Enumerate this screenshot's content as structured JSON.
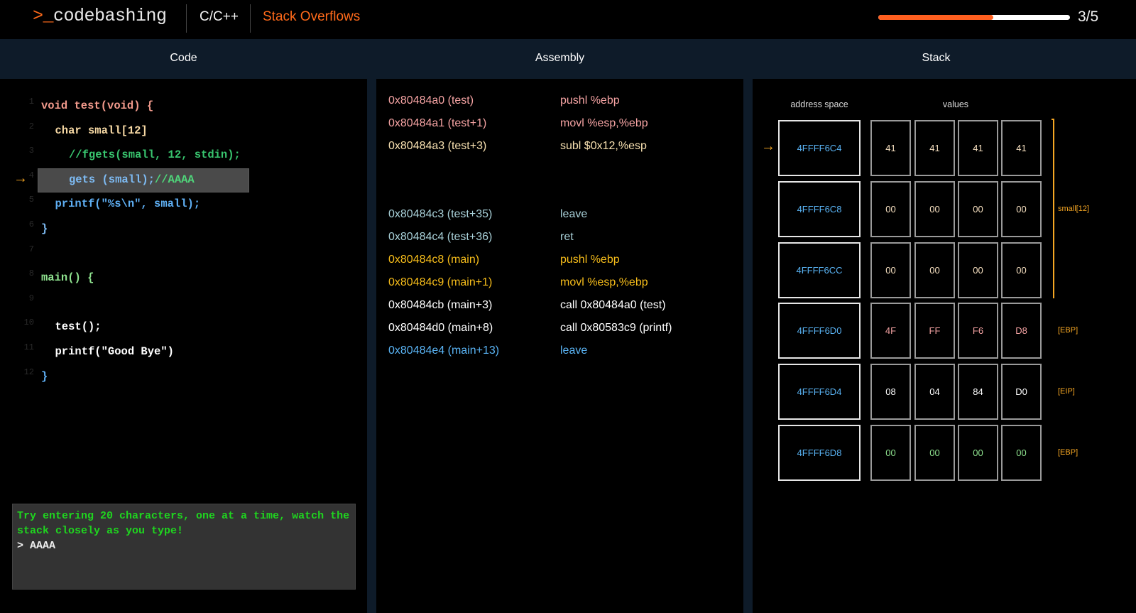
{
  "header": {
    "logo_prompt": ">_",
    "logo_text": "codebashing",
    "language": "C/C++",
    "lesson": "Stack Overflows",
    "progress_percent": 60,
    "step": "3/5",
    "colors": {
      "accent": "#ff6a1a"
    }
  },
  "columns": {
    "code": "Code",
    "assembly": "Assembly",
    "stack": "Stack"
  },
  "code": {
    "current_line": 4,
    "current_line_icon": "arrow-right-icon",
    "lines": [
      {
        "n": "1",
        "parts": [
          {
            "t": "void test(void) {",
            "c": "#f29a8c"
          }
        ],
        "indent": 0
      },
      {
        "n": "2",
        "parts": [
          {
            "t": "char small[12]",
            "c": "#f7d9a4"
          }
        ],
        "indent": 1
      },
      {
        "n": "3",
        "parts": [
          {
            "t": "//fgets(small, 12, stdin);",
            "c": "#38c46e"
          }
        ],
        "indent": 2
      },
      {
        "n": "4",
        "parts": [
          {
            "t": "gets (small);",
            "c": "#7dbaf2"
          },
          {
            "t": "//AAAA",
            "c": "#4fd67a"
          }
        ],
        "indent": 2
      },
      {
        "n": "5",
        "parts": [
          {
            "t": "printf(\"%s\\n\", small);",
            "c": "#5fb0f5"
          }
        ],
        "indent": 1
      },
      {
        "n": "6",
        "parts": [
          {
            "t": "}",
            "c": "#7dbaf2"
          }
        ],
        "indent": 0
      },
      {
        "n": "7",
        "parts": [],
        "indent": 0
      },
      {
        "n": "8",
        "parts": [
          {
            "t": "main() {",
            "c": "#8fe38f"
          }
        ],
        "indent": 0
      },
      {
        "n": "9",
        "parts": [],
        "indent": 0
      },
      {
        "n": "10",
        "parts": [
          {
            "t": "test();",
            "c": "#ffffff"
          }
        ],
        "indent": 1
      },
      {
        "n": "11",
        "parts": [
          {
            "t": "printf(\"Good Bye\")",
            "c": "#ffffff"
          }
        ],
        "indent": 1
      },
      {
        "n": "12",
        "parts": [
          {
            "t": "}",
            "c": "#5fb0f5"
          }
        ],
        "indent": 0
      }
    ]
  },
  "terminal": {
    "message": "Try entering 20 characters, one at a time, watch the stack closely as you type!",
    "prompt": "> AAAA"
  },
  "assembly": [
    {
      "addr": "0x80484a0 (test)",
      "instr": "pushl %ebp",
      "c": "#f5a3a3"
    },
    {
      "addr": "0x80484a1 (test+1)",
      "instr": "movl %esp,%ebp",
      "c": "#f5a3a3"
    },
    {
      "addr": "0x80484a3 (test+3)",
      "instr": "subl $0x12,%esp",
      "c": "#f7e0b0"
    },
    {
      "addr": "0x80484c3 (test+35)",
      "instr": "leave",
      "c": "#a8d0d8"
    },
    {
      "addr": "0x80484c4 (test+36)",
      "instr": "ret",
      "c": "#a8d0d8"
    },
    {
      "addr": "0x80484c8 (main)",
      "instr": "pushl %ebp",
      "c": "#f7bd1a"
    },
    {
      "addr": "0x80484c9 (main+1)",
      "instr": "movl %esp,%ebp",
      "c": "#f7bd1a"
    },
    {
      "addr": "0x80484cb (main+3)",
      "instr": "call 0x80484a0 (test)",
      "c": "#ffffff"
    },
    {
      "addr": "0x80484d0 (main+8)",
      "instr": "call 0x80583c9 (printf)",
      "c": "#ffffff"
    },
    {
      "addr": "0x80484e4 (main+13)",
      "instr": "leave",
      "c": "#5ab4f5"
    }
  ],
  "stack": {
    "address_header": "address space",
    "values_header": "values",
    "current_row": 0,
    "rows": [
      {
        "addr": "4FFFF6C4",
        "values": [
          "41",
          "41",
          "41",
          "41"
        ],
        "c": "#f7e0c0",
        "label": ""
      },
      {
        "addr": "4FFFF6C8",
        "values": [
          "00",
          "00",
          "00",
          "00"
        ],
        "c": "#f7e0c0",
        "label": ""
      },
      {
        "addr": "4FFFF6CC",
        "values": [
          "00",
          "00",
          "00",
          "00"
        ],
        "c": "#f7e0c0",
        "label": ""
      },
      {
        "addr": "4FFFF6D0",
        "values": [
          "4F",
          "FF",
          "F6",
          "D8"
        ],
        "c": "#f5a3a3",
        "label": "[EBP]"
      },
      {
        "addr": "4FFFF6D4",
        "values": [
          "08",
          "04",
          "84",
          "D0"
        ],
        "c": "#ffffff",
        "label": "[EIP]"
      },
      {
        "addr": "4FFFF6D8",
        "values": [
          "00",
          "00",
          "00",
          "00"
        ],
        "c": "#8fe38f",
        "label": "[EBP]"
      }
    ],
    "bracket_label": "small[12]",
    "address_color": "#5ab4f5"
  }
}
